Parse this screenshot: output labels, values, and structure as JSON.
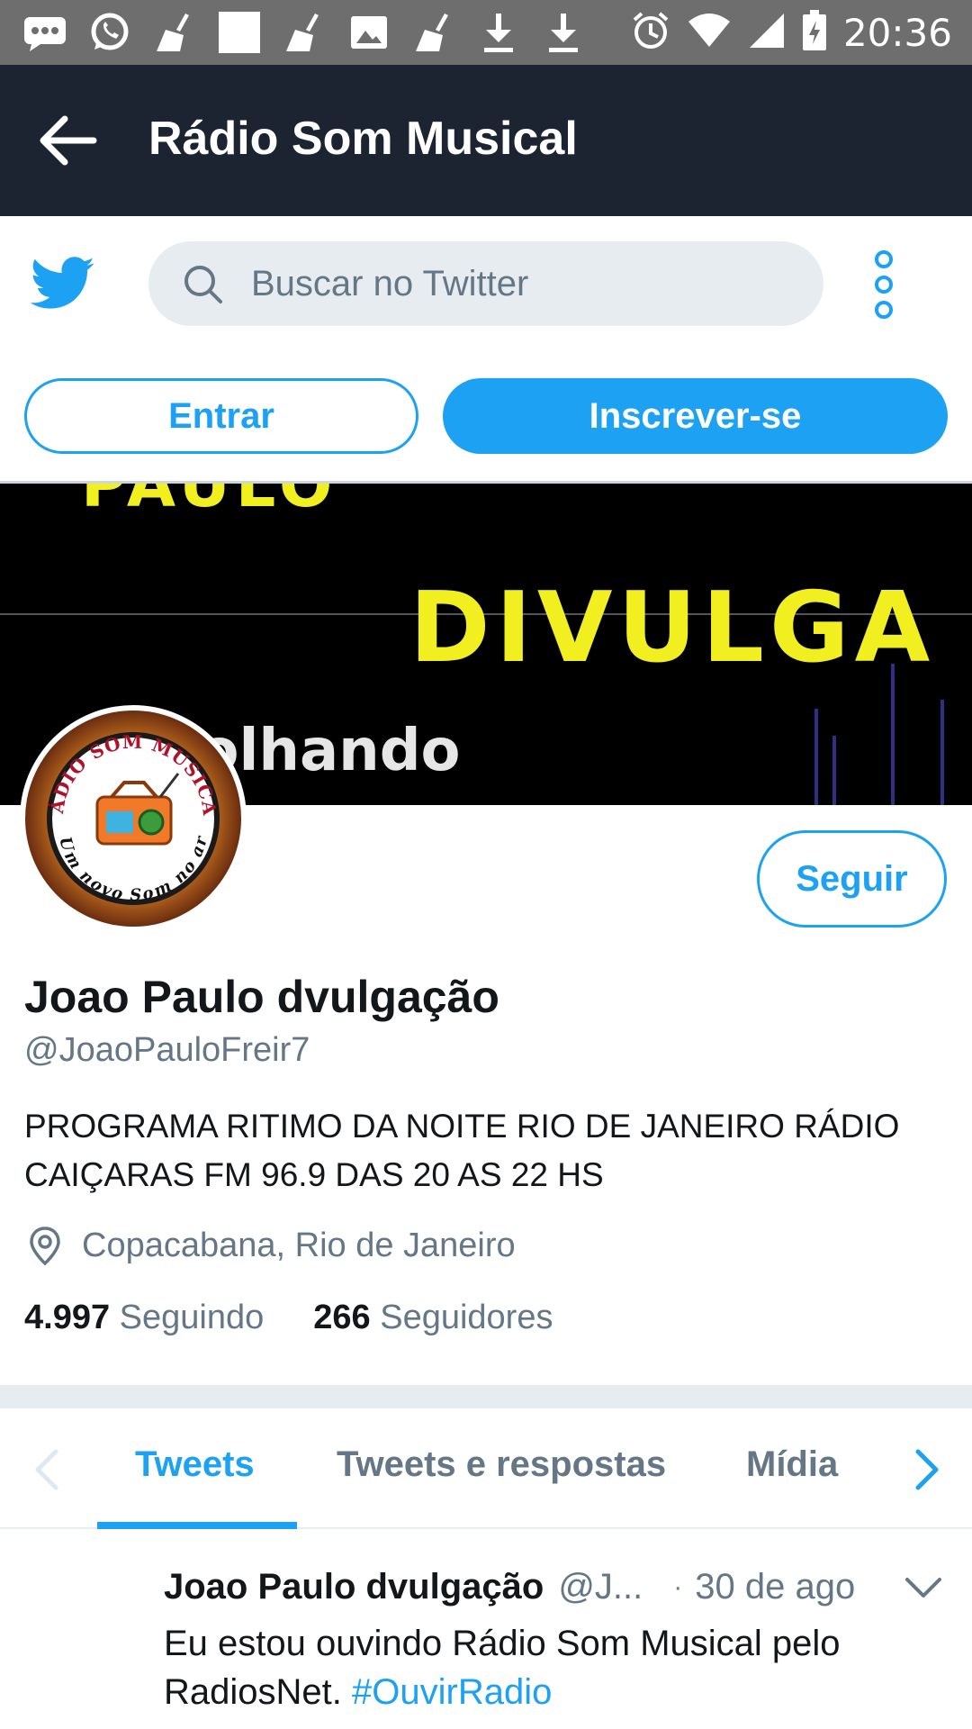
{
  "status_bar": {
    "time": "20:36",
    "icons": [
      "messages-icon",
      "whatsapp-icon",
      "broom-icon",
      "blank-square-icon",
      "broom-icon",
      "image-icon",
      "broom-icon",
      "download-icon",
      "download-icon",
      "alarm-icon",
      "wifi-icon",
      "signal-icon",
      "battery-icon"
    ]
  },
  "app_bar": {
    "title": "Rádio Som Musical"
  },
  "twitter_header": {
    "search_placeholder": "Buscar no Twitter"
  },
  "auth": {
    "login_label": "Entrar",
    "signup_label": "Inscrever-se"
  },
  "banner": {
    "word_top": "PAULO",
    "word_main": "DIVULGA",
    "word_sub": "esolhando"
  },
  "avatar": {
    "ring_text": "RÁDIO SOM MUSICAL",
    "ring_text_bottom": "Um novo Som no ar"
  },
  "profile": {
    "follow_label": "Seguir",
    "name": "Joao Paulo dvulgação",
    "handle": "@JoaoPauloFreir7",
    "bio": "PROGRAMA RITIMO DA NOITE RIO DE JANEIRO RÁDIO CAIÇARAS FM 96.9 DAS 20 AS 22 HS",
    "location": "Copacabana, Rio de Janeiro",
    "following_count": "4.997",
    "following_label": "Seguindo",
    "followers_count": "266",
    "followers_label": "Seguidores"
  },
  "tabs": [
    {
      "label": "Tweets",
      "active": true
    },
    {
      "label": "Tweets e respostas",
      "active": false
    },
    {
      "label": "Mídia",
      "active": false
    }
  ],
  "tweet": {
    "author": "Joao Paulo dvulgação",
    "handle": "@J...",
    "separator": "·",
    "time": "30 de ago",
    "text": "Eu estou ouvindo Rádio Som Musical pelo RadiosNet.",
    "hashtag": "#OuvirRadio"
  },
  "colors": {
    "twitter_blue": "#1da1f2",
    "app_bar": "#1c2331",
    "status_bar": "#6e6e6e",
    "muted_text": "#657786",
    "banner_yellow": "#f1ef1f"
  }
}
